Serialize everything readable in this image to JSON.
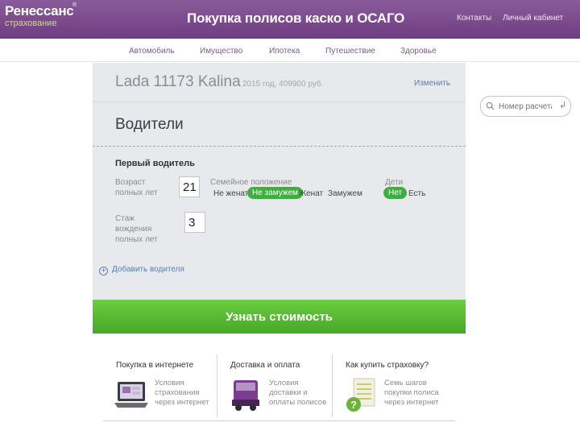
{
  "brand": {
    "name": "Ренессанс",
    "sub": "страхование",
    "reg": "®"
  },
  "page": {
    "title": "Покупка полисов каско и ОСАГО"
  },
  "top_links": [
    "Контакты",
    "Личный кабинет"
  ],
  "nav": [
    "Автомобиль",
    "Имущество",
    "Ипотека",
    "Путешествие",
    "Здоровье"
  ],
  "car": {
    "title": "Lada 11173 Kalina",
    "meta": "2015 год, 409900 руб.",
    "change": "Изменить"
  },
  "section": {
    "title": "Водители"
  },
  "driver": {
    "title": "Первый водитель",
    "age_label": "Возраст полных лет",
    "age_value": "21",
    "exp_label": "Стаж вождения полных лет",
    "exp_value": "3",
    "family_label": "Семейное положение",
    "family_options": [
      "Не женат",
      "Не замужем",
      "Женат",
      "Замужем"
    ],
    "family_selected": "Не замужем",
    "kids_label": "Дети",
    "kids_options": [
      "Нет",
      "Есть"
    ],
    "kids_selected": "Нет"
  },
  "add_driver": "Добавить водителя",
  "cta": "Узнать стоимость",
  "search": {
    "placeholder": "Номер расчета",
    "icon": "search-icon",
    "enter_icon": "↲"
  },
  "bottom": [
    {
      "title": "Покупка в интернете",
      "desc": "Условия страхования через интернет"
    },
    {
      "title": "Доставка и оплата",
      "desc": "Условия доставки и оплаты полисов"
    },
    {
      "title": "Как купить страховку?",
      "desc": "Семь шагов покупки полиса через интернет"
    }
  ],
  "colors": {
    "header": "#7a4a8c",
    "accent": "#3fae3f",
    "cta": "#55b832",
    "link": "#5a7fb4"
  }
}
